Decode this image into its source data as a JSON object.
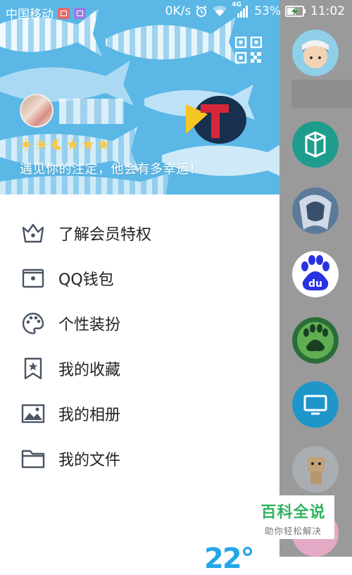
{
  "status_bar": {
    "carrier": "中国移动",
    "net_speed": "0K/s",
    "network_type": "4G",
    "battery_percent": "53%",
    "time": "11:02"
  },
  "profile": {
    "signature": "遇见你的注定，他会有多幸运！",
    "level_icons": [
      "sun-icon",
      "sun-icon",
      "moon-icon",
      "star-icon",
      "star-icon",
      "star-icon"
    ]
  },
  "menu": {
    "items": [
      {
        "label": "了解会员特权",
        "icon": "crown-icon"
      },
      {
        "label": "QQ钱包",
        "icon": "wallet-icon"
      },
      {
        "label": "个性装扮",
        "icon": "palette-icon"
      },
      {
        "label": "我的收藏",
        "icon": "bookmark-star-icon"
      },
      {
        "label": "我的相册",
        "icon": "photo-icon"
      },
      {
        "label": "我的文件",
        "icon": "folder-icon"
      }
    ]
  },
  "weather": {
    "temperature": "22°"
  },
  "watermark": {
    "title": "百科全说",
    "subtitle": "助你轻松解决"
  },
  "colors": {
    "header_bg": "#5ab7e6",
    "icon_gray": "#4a5565",
    "overlay": "#9a9a9a",
    "accent_blue": "#23a6e8",
    "watermark_green": "#2fb35f"
  }
}
